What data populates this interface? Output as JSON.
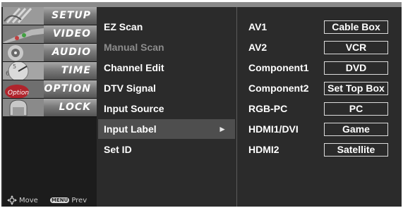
{
  "categories": [
    {
      "label": "SETUP",
      "icon": "satellite-dish-icon"
    },
    {
      "label": "VIDEO",
      "icon": "film-strip-icon"
    },
    {
      "label": "AUDIO",
      "icon": "speaker-icon"
    },
    {
      "label": "TIME",
      "icon": "clock-icon"
    },
    {
      "label": "OPTION",
      "icon": "option-tag-icon"
    },
    {
      "label": "LOCK",
      "icon": "lock-icon"
    }
  ],
  "footer": {
    "move_label": "Move",
    "menu_key": "MENU",
    "prev_label": "Prev"
  },
  "menu": {
    "items": [
      {
        "label": "EZ Scan",
        "state": "normal"
      },
      {
        "label": "Manual Scan",
        "state": "disabled"
      },
      {
        "label": "Channel Edit",
        "state": "normal"
      },
      {
        "label": "DTV Signal",
        "state": "normal"
      },
      {
        "label": "Input Source",
        "state": "normal"
      },
      {
        "label": "Input Label",
        "state": "selected",
        "arrow": "►"
      },
      {
        "label": "Set ID",
        "state": "normal"
      }
    ]
  },
  "input_labels": [
    {
      "source": "AV1",
      "label": "Cable Box"
    },
    {
      "source": "AV2",
      "label": "VCR"
    },
    {
      "source": "Component1",
      "label": "DVD"
    },
    {
      "source": "Component2",
      "label": "Set Top Box"
    },
    {
      "source": "RGB-PC",
      "label": "PC"
    },
    {
      "source": "HDMI1/DVI",
      "label": "Game"
    },
    {
      "source": "HDMI2",
      "label": "Satellite"
    }
  ],
  "colors": {
    "background": "#2b2b2b",
    "selected_row": "#4e4e4e",
    "disabled_text": "#8c8c8c",
    "text": "#ffffff"
  }
}
